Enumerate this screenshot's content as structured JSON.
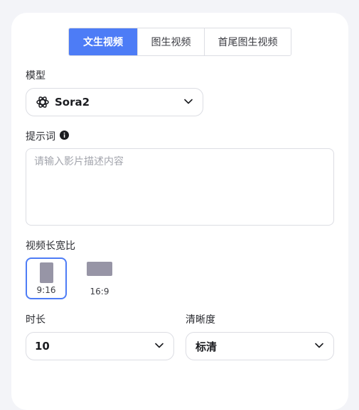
{
  "tabs": [
    {
      "label": "文生视频",
      "active": true
    },
    {
      "label": "图生视频",
      "active": false
    },
    {
      "label": "首尾图生视频",
      "active": false
    }
  ],
  "model": {
    "label": "模型",
    "value": "Sora2",
    "icon": "openai-logo-icon"
  },
  "prompt": {
    "label": "提示词",
    "info_icon": "info-icon",
    "placeholder": "请输入影片描述内容",
    "value": ""
  },
  "aspect": {
    "label": "视频长宽比",
    "options": [
      {
        "label": "9:16",
        "selected": true
      },
      {
        "label": "16:9",
        "selected": false
      }
    ]
  },
  "duration": {
    "label": "时长",
    "value": "10"
  },
  "clarity": {
    "label": "清晰度",
    "value": "标清"
  },
  "colors": {
    "accent": "#4d7cf6",
    "shape": "#9795a6",
    "border": "#dcdde3",
    "page_bg": "#f3f4f8"
  }
}
